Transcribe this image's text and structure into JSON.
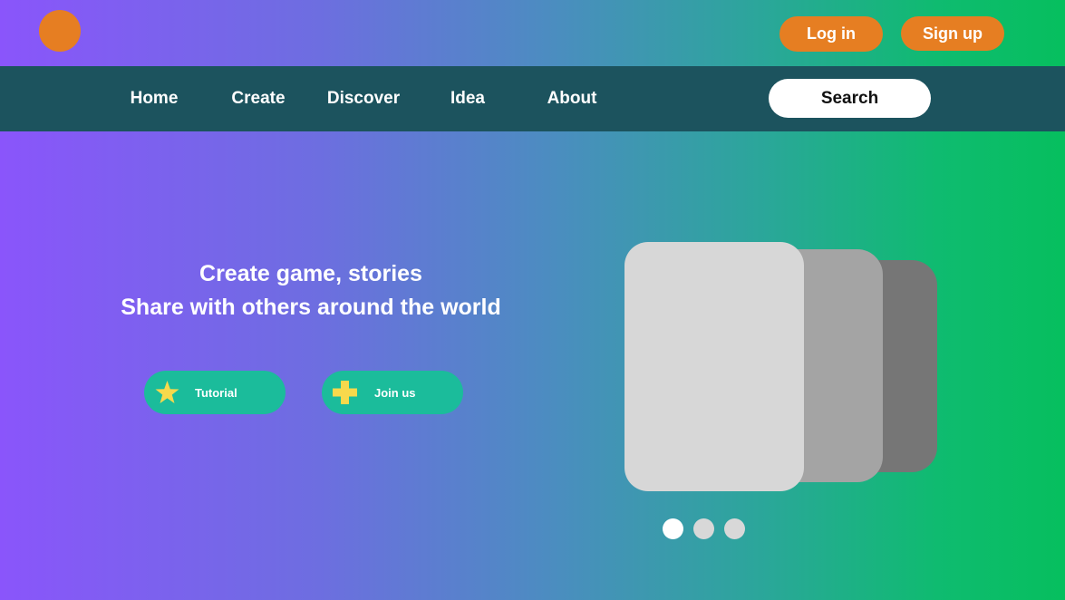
{
  "header": {
    "login_label": "Log in",
    "signup_label": "Sign up",
    "brand_color": "#e67e22"
  },
  "nav": {
    "items": [
      {
        "label": "Home"
      },
      {
        "label": "Create"
      },
      {
        "label": "Discover"
      },
      {
        "label": "Idea"
      },
      {
        "label": "About"
      }
    ],
    "search_label": "Search",
    "bar_color": "#1c535e"
  },
  "hero": {
    "title_line1": "Create game, stories",
    "title_line2": "Share with others around the world",
    "buttons": [
      {
        "label": "Tutorial",
        "icon": "star-icon"
      },
      {
        "label": "Join us",
        "icon": "plus-icon"
      }
    ],
    "button_color": "#1bbc9b",
    "icon_color": "#f7d94c"
  },
  "carousel": {
    "slide_count": 3,
    "active_index": 0
  }
}
